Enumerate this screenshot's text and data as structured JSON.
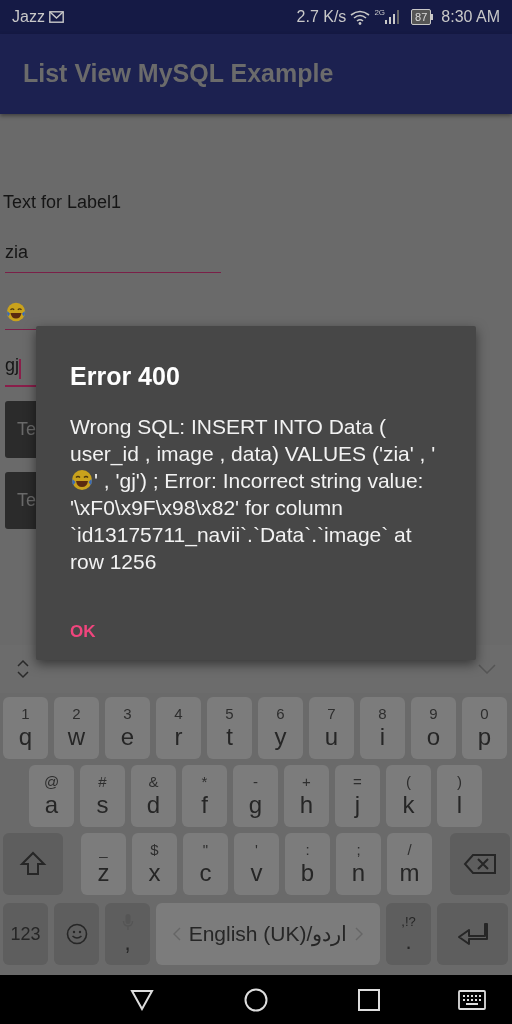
{
  "status_bar": {
    "carrier": "Jazz",
    "speed": "2.7 K/s",
    "network": "2G",
    "battery": "87",
    "time": "8:30 AM"
  },
  "app_bar": {
    "title": "List View MySQL Example"
  },
  "form": {
    "label": "Text for Label1",
    "fields": [
      {
        "kind": "text",
        "value": "zia",
        "focused": false
      },
      {
        "kind": "emoji",
        "focused": false
      },
      {
        "kind": "text",
        "value": "gj",
        "focused": true
      }
    ],
    "buttons": [
      "Te",
      "Te"
    ]
  },
  "dialog": {
    "title": "Error 400",
    "message": [
      {
        "kind": "text",
        "text": "Wrong SQL: INSERT INTO Data ( user_id , image , data) VALUES ('zia' , '"
      },
      {
        "kind": "emoji"
      },
      {
        "kind": "text",
        "text": "' , 'gj') ; Error: Incorrect string value: '\\xF0\\x9F\\x98\\x82' for column `id13175711_navii`.`Data`.`image` at row 1256"
      }
    ],
    "button": "OK"
  },
  "keyboard": {
    "rows": [
      {
        "keys": [
          {
            "kind": "letter",
            "hint": "1",
            "label": "q"
          },
          {
            "kind": "letter",
            "hint": "2",
            "label": "w"
          },
          {
            "kind": "letter",
            "hint": "3",
            "label": "e"
          },
          {
            "kind": "letter",
            "hint": "4",
            "label": "r"
          },
          {
            "kind": "letter",
            "hint": "5",
            "label": "t"
          },
          {
            "kind": "letter",
            "hint": "6",
            "label": "y"
          },
          {
            "kind": "letter",
            "hint": "7",
            "label": "u"
          },
          {
            "kind": "letter",
            "hint": "8",
            "label": "i"
          },
          {
            "kind": "letter",
            "hint": "9",
            "label": "o"
          },
          {
            "kind": "letter",
            "hint": "0",
            "label": "p"
          }
        ]
      },
      {
        "keys": [
          {
            "kind": "letter",
            "hint": "@",
            "label": "a"
          },
          {
            "kind": "letter",
            "hint": "#",
            "label": "s"
          },
          {
            "kind": "letter",
            "hint": "&",
            "label": "d"
          },
          {
            "kind": "letter",
            "hint": "*",
            "label": "f"
          },
          {
            "kind": "letter",
            "hint": "-",
            "label": "g"
          },
          {
            "kind": "letter",
            "hint": "+",
            "label": "h"
          },
          {
            "kind": "letter",
            "hint": "=",
            "label": "j"
          },
          {
            "kind": "letter",
            "hint": "(",
            "label": "k"
          },
          {
            "kind": "letter",
            "hint": ")",
            "label": "l"
          }
        ]
      },
      {
        "keys": [
          {
            "kind": "shift"
          },
          {
            "kind": "letter",
            "hint": "_",
            "label": "z"
          },
          {
            "kind": "letter",
            "hint": "$",
            "label": "x"
          },
          {
            "kind": "letter",
            "hint": "\"",
            "label": "c"
          },
          {
            "kind": "letter",
            "hint": "'",
            "label": "v"
          },
          {
            "kind": "letter",
            "hint": ":",
            "label": "b"
          },
          {
            "kind": "letter",
            "hint": ";",
            "label": "n"
          },
          {
            "kind": "letter",
            "hint": "/",
            "label": "m"
          },
          {
            "kind": "backspace"
          }
        ]
      },
      {
        "keys": [
          {
            "kind": "symbols",
            "label": "123"
          },
          {
            "kind": "emoji"
          },
          {
            "kind": "mic",
            "label": ","
          },
          {
            "kind": "space",
            "label": "English (UK)/اردو"
          },
          {
            "kind": "punct",
            "hint": ",!?",
            "label": "."
          },
          {
            "kind": "enter"
          }
        ]
      }
    ]
  }
}
